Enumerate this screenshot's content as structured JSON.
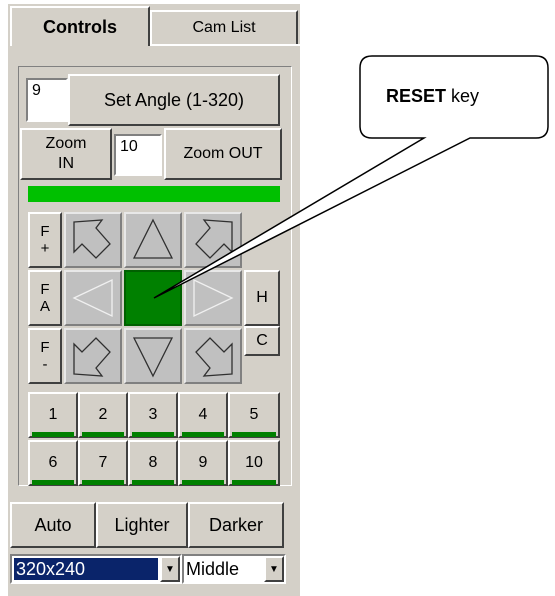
{
  "tabs": [
    {
      "label": "Controls"
    },
    {
      "label": "Cam List"
    }
  ],
  "angle": {
    "value": "9",
    "button_label": "Set Angle (1-320)"
  },
  "zoom": {
    "in_label": "Zoom IN",
    "value": "10",
    "out_label": "Zoom OUT"
  },
  "focus_labels": {
    "near": "F +",
    "auto": "F A",
    "far": "F -"
  },
  "side_buttons": {
    "h": "H",
    "c": "C"
  },
  "presets": [
    "1",
    "2",
    "3",
    "4",
    "5",
    "6",
    "7",
    "8",
    "9",
    "10"
  ],
  "exposure": {
    "auto": "Auto",
    "lighter": "Lighter",
    "darker": "Darker"
  },
  "resolution": {
    "value": "320x240"
  },
  "quality": {
    "value": "Middle"
  },
  "callout": {
    "bold": "RESET",
    "rest": " key"
  },
  "colors": {
    "panel": "#d4d0c8",
    "status_green": "#00c000",
    "reset_green": "#008000",
    "selection_blue": "#0a246a"
  },
  "icons": {
    "dropdown": "triangle-down"
  }
}
